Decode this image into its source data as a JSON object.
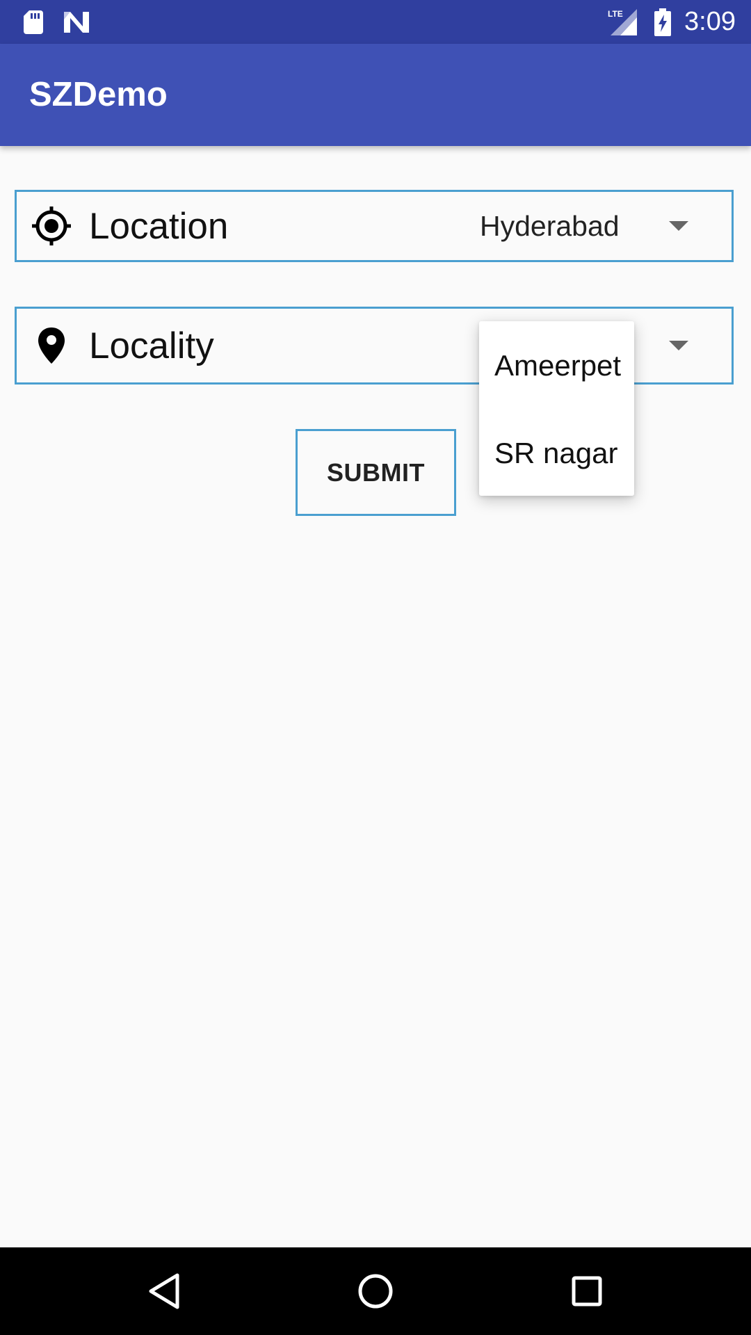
{
  "status_bar": {
    "time": "3:09",
    "network_label": "LTE",
    "icons": [
      "sd-card-icon",
      "notification-n-icon",
      "lte-signal-icon",
      "battery-charging-icon"
    ]
  },
  "app_bar": {
    "title": "SZDemo",
    "color": "#3f51b5"
  },
  "form": {
    "location": {
      "label": "Location",
      "icon": "crosshair-location-icon",
      "selected_value": "Hyderabad"
    },
    "locality": {
      "label": "Locality",
      "icon": "map-pin-icon",
      "dropdown_open": true,
      "options": [
        "Ameerpet",
        "SR nagar"
      ]
    },
    "submit_label": "SUBMIT"
  },
  "nav_bar": {
    "buttons": [
      "back-icon",
      "home-icon",
      "recents-icon"
    ]
  },
  "colors": {
    "status_bar": "#303f9f",
    "primary": "#3f51b5",
    "field_border": "#4a9fd0",
    "background": "#fafafa"
  }
}
